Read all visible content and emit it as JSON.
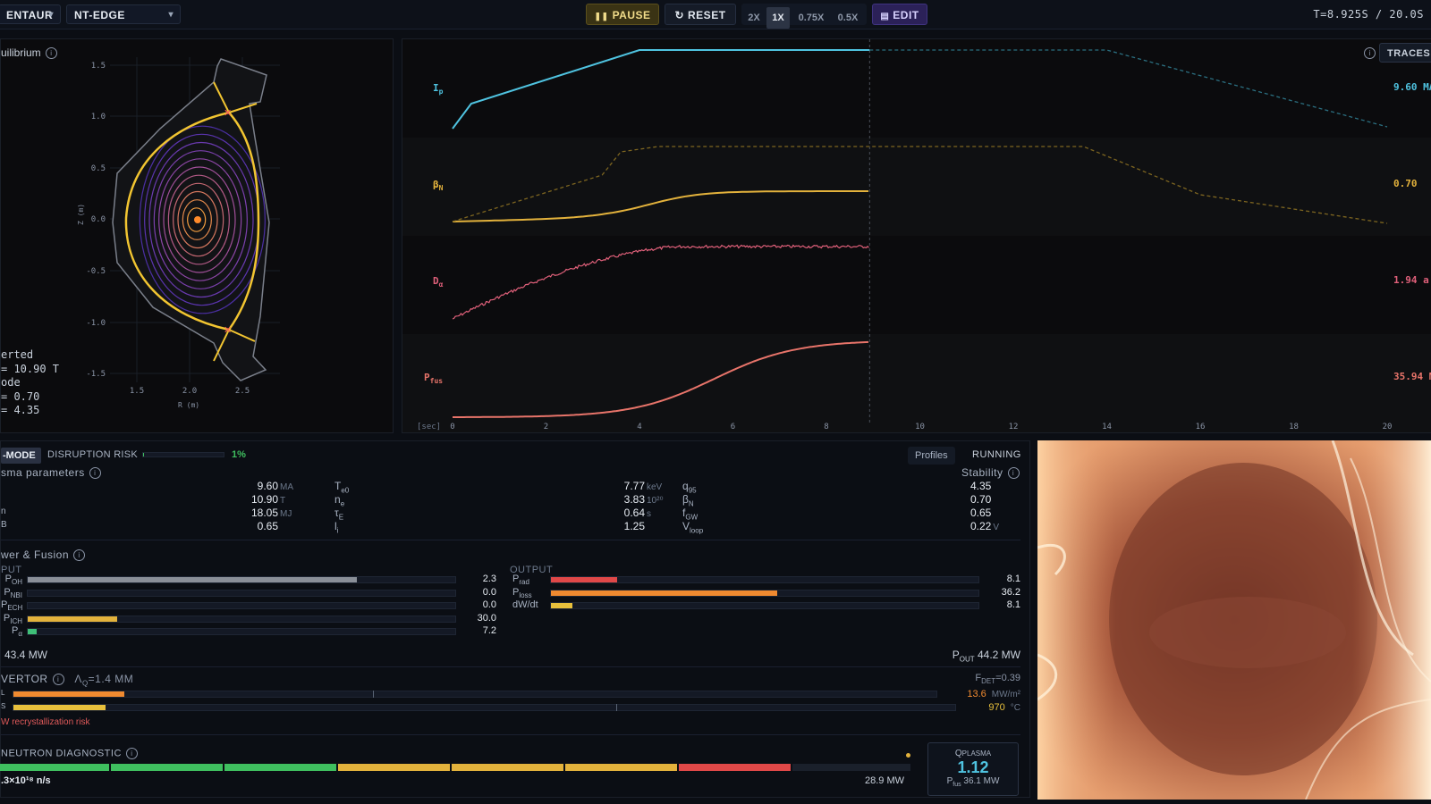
{
  "toolbar": {
    "machine_select": "ENTAUR",
    "scenario_select": "NT-EDGE",
    "pause_label": "PAUSE",
    "reset_label": "RESET",
    "speeds": [
      "2X",
      "1X",
      "0.75X",
      "0.5X"
    ],
    "active_speed": "1X",
    "edit_label": "EDIT",
    "time_readout": "T=8.925S / 20.0S"
  },
  "equilibrium": {
    "title": "uilibrium",
    "y_axis_label": "Z (m)",
    "x_axis_label": "R (m)",
    "y_ticks": [
      "1.5",
      "1.0",
      "0.5",
      "0.0",
      "-0.5",
      "-1.0",
      "-1.5"
    ],
    "x_ticks": [
      "1.5",
      "2.0",
      "2.5"
    ],
    "info_lines": [
      "erted",
      "= 10.90 T",
      "ode",
      "= 0.70",
      "= 4.35"
    ]
  },
  "traces": {
    "button_label": "TRACES",
    "x_axis_label": "[sec]",
    "x_ticks": [
      "0",
      "2",
      "4",
      "6",
      "8",
      "10",
      "12",
      "14",
      "16",
      "18",
      "20"
    ],
    "current_time": 8.925,
    "channels": [
      {
        "label": "I",
        "sub": "p",
        "value": "9.60 MA",
        "color": "#4fc3e0"
      },
      {
        "label": "β",
        "sub": "N",
        "value": "0.70",
        "color": "#e3b23c"
      },
      {
        "label": "D",
        "sub": "α",
        "value": "1.94 a.",
        "color": "#e0607a"
      },
      {
        "label": "P",
        "sub": "fus",
        "value": "35.94 M",
        "color": "#e8746a"
      }
    ]
  },
  "status": {
    "mode_label": "-MODE",
    "disruption_label": "DISRUPTION RISK",
    "disruption_value": "1%",
    "disruption_fraction": 0.01,
    "profiles_label": "Profiles",
    "running_label": "RUNNING"
  },
  "plasma": {
    "section_title": "sma parameters",
    "stability_title": "Stability",
    "col1": [
      {
        "value": "9.60",
        "unit": "MA"
      },
      {
        "value": "10.90",
        "unit": "T"
      },
      {
        "value": "18.05",
        "unit": "MJ"
      },
      {
        "value": "0.65",
        "unit": ""
      }
    ],
    "col1_labels": [
      "",
      "",
      "n",
      "B"
    ],
    "col2_labels": [
      {
        "main": "T",
        "sub": "e0"
      },
      {
        "main": "n",
        "sub": "e"
      },
      {
        "main": "τ",
        "sub": "E"
      },
      {
        "main": "l",
        "sub": "i"
      }
    ],
    "col2": [
      {
        "value": "7.77",
        "unit": "keV"
      },
      {
        "value": "3.83",
        "unit": "10²⁰"
      },
      {
        "value": "0.64",
        "unit": "s"
      },
      {
        "value": "1.25",
        "unit": ""
      }
    ],
    "col3_labels": [
      {
        "main": "q",
        "sub": "95"
      },
      {
        "main": "β",
        "sub": "N"
      },
      {
        "main": "f",
        "sub": "GW"
      },
      {
        "main": "V",
        "sub": "loop"
      }
    ],
    "col3": [
      {
        "value": "4.35",
        "unit": ""
      },
      {
        "value": "0.70",
        "unit": ""
      },
      {
        "value": "0.65",
        "unit": ""
      },
      {
        "value": "0.22",
        "unit": "V"
      }
    ]
  },
  "power": {
    "section_title": "wer & Fusion",
    "input_title": "PUT",
    "output_title": "OUTPUT",
    "inputs": [
      {
        "main": "P",
        "sub": "OH",
        "value": "2.3",
        "fraction": 0.77,
        "color": "#8a8f98"
      },
      {
        "main": "P",
        "sub": "NBI",
        "value": "0.0",
        "fraction": 0.0,
        "color": "#e3b23c"
      },
      {
        "main": "P",
        "sub": "ECH",
        "value": "0.0",
        "fraction": 0.0,
        "color": "#e3b23c"
      },
      {
        "main": "P",
        "sub": "ICH",
        "value": "30.0",
        "fraction": 0.21,
        "color": "#e3b23c"
      },
      {
        "main": "P",
        "sub": "α",
        "value": "7.2",
        "fraction": 0.02,
        "color": "#3fbf78"
      }
    ],
    "outputs": [
      {
        "main": "P",
        "sub": "rad",
        "value": "8.1",
        "fraction": 0.155,
        "color": "#e04848"
      },
      {
        "main": "P",
        "sub": "loss",
        "value": "36.2",
        "fraction": 0.53,
        "color": "#f08a30"
      },
      {
        "main": "dW/dt",
        "sub": "",
        "value": "8.1",
        "fraction": 0.05,
        "color": "#e8c03c"
      }
    ],
    "p_in_total": "43.4 MW",
    "p_out_label": "P",
    "p_out_sub": "OUT",
    "p_out_total": "44.2 MW"
  },
  "divertor": {
    "section_title": "VERTOR",
    "lambda_label": "Λ",
    "lambda_sub": "Q",
    "lambda_value": "=1.4 MM",
    "fdet_label": "F",
    "fdet_sub": "DET",
    "fdet_value": "=0.39",
    "rows": [
      {
        "label": "L",
        "value": "13.6",
        "unit": "MW/m²",
        "fraction": 0.12,
        "color": "#f08a30",
        "value_color": "#f08a30"
      },
      {
        "label": "S",
        "value": "970",
        "unit": "°C",
        "fraction": 0.098,
        "color": "#e8c03c",
        "value_color": "#e8c03c"
      }
    ],
    "warning": "W recrystallization risk"
  },
  "neutron": {
    "section_title": "NEUTRON DIAGNOSTIC",
    "rate": ".3×10¹⁸ n/s",
    "power": "28.9 MW",
    "segments": [
      "#3fbf5f",
      "#3fbf5f",
      "#3fbf5f",
      "#e3b23c",
      "#e3b23c",
      "#e3b23c",
      "#e04848",
      "#1a202b"
    ]
  },
  "q_plasma": {
    "label": "Q",
    "label_sub": "PLASMA",
    "value": "1.12",
    "pfus_label": "P",
    "pfus_sub": "fus",
    "pfus_value": "36.1 MW"
  }
}
